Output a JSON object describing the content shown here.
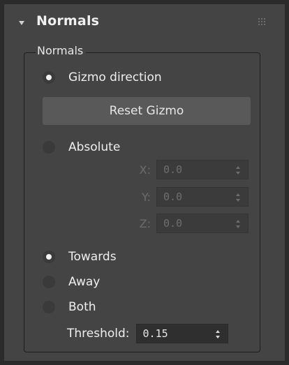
{
  "rollout": {
    "title": "Normals",
    "expand_icon": "triangle-down-icon",
    "grip_icon": "drag-grip-icon"
  },
  "group": {
    "label": "Normals"
  },
  "options": {
    "gizmo_direction": {
      "label": "Gizmo direction",
      "checked": true
    },
    "reset_gizmo_label": "Reset Gizmo",
    "absolute": {
      "label": "Absolute",
      "checked": false
    },
    "x": {
      "label": "X:",
      "value": "0.0",
      "enabled": false
    },
    "y": {
      "label": "Y:",
      "value": "0.0",
      "enabled": false
    },
    "z": {
      "label": "Z:",
      "value": "0.0",
      "enabled": false
    },
    "towards": {
      "label": "Towards",
      "checked": true
    },
    "away": {
      "label": "Away",
      "checked": false
    },
    "both": {
      "label": "Both",
      "checked": false
    },
    "threshold": {
      "label": "Threshold:",
      "value": "0.15",
      "enabled": true
    }
  },
  "colors": {
    "panel_bg": "#444444",
    "outer_bg": "#2b2b2b",
    "button_bg": "#595959",
    "disabled_text": "#6e6e6e",
    "text": "#efefef"
  }
}
